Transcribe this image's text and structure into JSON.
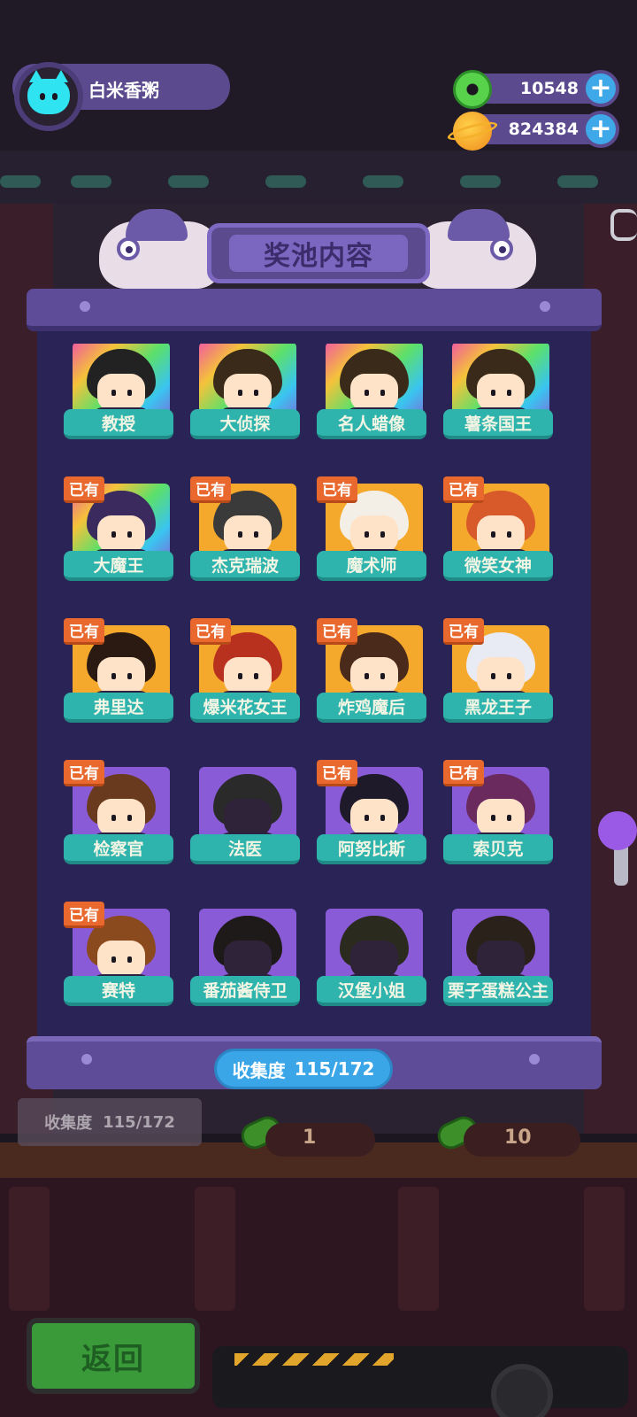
{
  "player": {
    "name": "白米香粥",
    "avatar_icon": "cyan-cat-icon"
  },
  "currencies": [
    {
      "icon": "donut-icon",
      "value": "10548"
    },
    {
      "icon": "planet-coin-icon",
      "value": "824384"
    }
  ],
  "panel": {
    "title": "奖池内容"
  },
  "characters": [
    {
      "name": "教授",
      "owned": false,
      "frame": "rainbow",
      "hair": "#222"
    },
    {
      "name": "大侦探",
      "owned": false,
      "frame": "rainbow",
      "hair": "#3a2a1a"
    },
    {
      "name": "名人蜡像",
      "owned": false,
      "frame": "rainbow",
      "hair": "#3a2a1a"
    },
    {
      "name": "薯条国王",
      "owned": false,
      "frame": "rainbow",
      "hair": "#3a2a1a"
    },
    {
      "name": "大魔王",
      "owned": true,
      "owned_label": "已有",
      "frame": "rainbow",
      "hair": "#3b2a5e"
    },
    {
      "name": "杰克瑞波",
      "owned": true,
      "owned_label": "已有",
      "frame": "gold",
      "hair": "#3a3a3a"
    },
    {
      "name": "魔术师",
      "owned": true,
      "owned_label": "已有",
      "frame": "gold",
      "hair": "#f4efe6"
    },
    {
      "name": "微笑女神",
      "owned": true,
      "owned_label": "已有",
      "frame": "gold",
      "hair": "#d85a2a"
    },
    {
      "name": "弗里达",
      "owned": true,
      "owned_label": "已有",
      "frame": "gold",
      "hair": "#2a1a12"
    },
    {
      "name": "爆米花女王",
      "owned": true,
      "owned_label": "已有",
      "frame": "gold",
      "hair": "#b8301e"
    },
    {
      "name": "炸鸡魔后",
      "owned": true,
      "owned_label": "已有",
      "frame": "gold",
      "hair": "#4a2a1a"
    },
    {
      "name": "黑龙王子",
      "owned": true,
      "owned_label": "已有",
      "frame": "gold",
      "hair": "#e8eaf4"
    },
    {
      "name": "检察官",
      "owned": true,
      "owned_label": "已有",
      "frame": "purple",
      "hair": "#6a3a1e"
    },
    {
      "name": "法医",
      "owned": false,
      "frame": "purple",
      "hair": "#2a2a2a",
      "shadow": true
    },
    {
      "name": "阿努比斯",
      "owned": true,
      "owned_label": "已有",
      "frame": "purple",
      "hair": "#1e1a2a"
    },
    {
      "name": "索贝克",
      "owned": true,
      "owned_label": "已有",
      "frame": "purple",
      "hair": "#6a2a5e"
    },
    {
      "name": "赛特",
      "owned": true,
      "owned_label": "已有",
      "frame": "purple",
      "hair": "#8a4a1e"
    },
    {
      "name": "番茄酱侍卫",
      "owned": false,
      "frame": "purple",
      "hair": "#1e1a1a",
      "shadow": true
    },
    {
      "name": "汉堡小姐",
      "owned": false,
      "frame": "purple",
      "hair": "#2a2a1e",
      "shadow": true
    },
    {
      "name": "栗子蛋糕公主",
      "owned": false,
      "frame": "purple",
      "hair": "#2a221a",
      "shadow": true
    },
    {
      "name": "",
      "owned": true,
      "owned_label": "已有",
      "frame": "purple",
      "hair": "#f5a92c"
    },
    {
      "name": "",
      "owned": false,
      "frame": "purple",
      "hair": "#2a2a2a",
      "shadow": true
    },
    {
      "name": "",
      "owned": false,
      "frame": "purple",
      "hair": "#2a2a2a",
      "shadow": true
    },
    {
      "name": "",
      "owned": false,
      "frame": "purple",
      "hair": "#2a2a2a",
      "shadow": true
    }
  ],
  "collection": {
    "label": "收集度",
    "value": "115/172"
  },
  "background": {
    "collection_label": "收集度",
    "collection_value": "115/172",
    "single_draw_cost": "1",
    "ten_draw_cost": "10"
  },
  "back_button": {
    "label": "返回"
  },
  "colors": {
    "owned_badge": "#e8682e",
    "name_bar": "#2fb3ad",
    "panel": "#2a2456",
    "accent_blue": "#3aa6e8"
  }
}
